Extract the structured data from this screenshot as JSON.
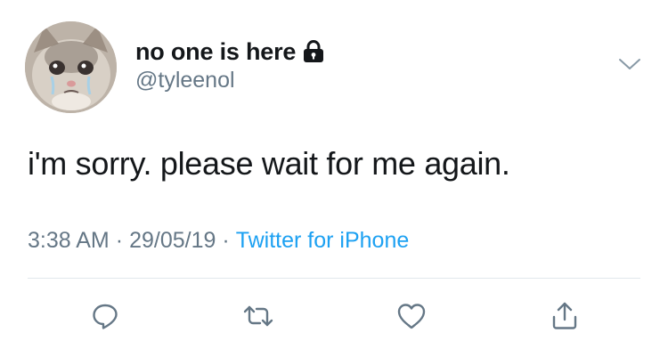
{
  "tweet": {
    "author": {
      "display_name": "no one is here",
      "handle": "@tyleenol",
      "protected": true,
      "avatar_description": "crying-cat-avatar"
    },
    "text": "i'm sorry. please wait for me again.",
    "time": "3:38 AM",
    "date": "29/05/19",
    "separator": "·",
    "source": "Twitter for iPhone"
  },
  "colors": {
    "text_primary": "#14171a",
    "text_secondary": "#657786",
    "link_blue": "#1da1f2",
    "divider": "#e1e8ed"
  },
  "icons": [
    "lock-icon",
    "chevron-down-icon",
    "reply-icon",
    "retweet-icon",
    "like-icon",
    "share-icon"
  ]
}
